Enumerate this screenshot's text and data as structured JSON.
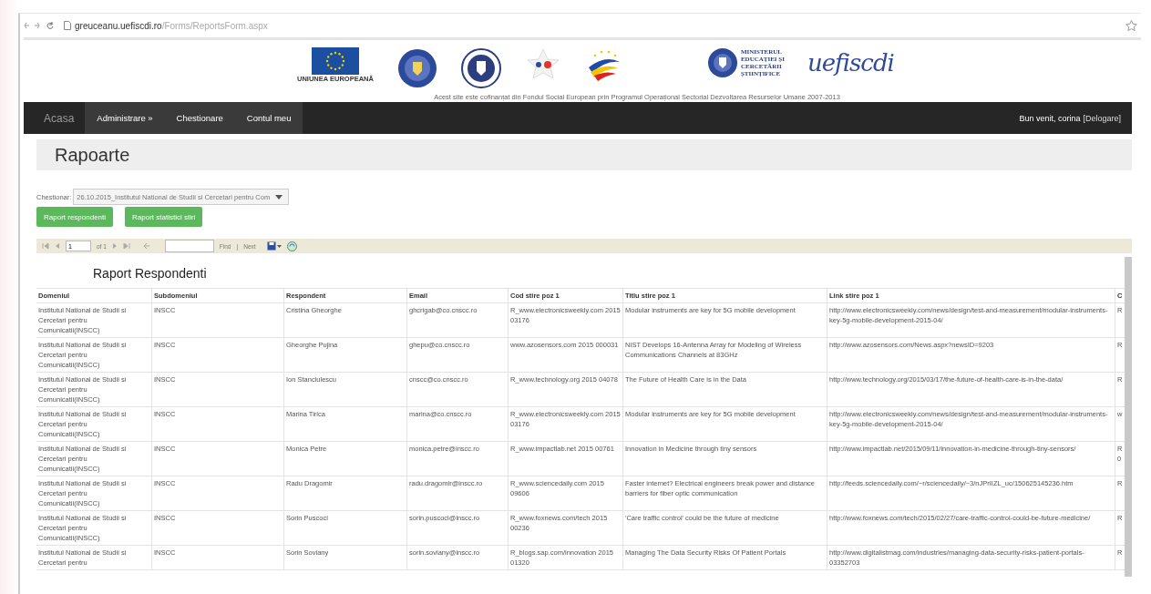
{
  "browser": {
    "url_host": "greuceanu.uefiscdi.ro",
    "url_path": "/Forms/ReportsForm.aspx"
  },
  "header": {
    "eu_caption": "UNIUNEA EUROPEANĂ",
    "ministry_text": "MINISTERUL EDUCAȚIEI ȘI CERCETĂRII ȘTIINȚIFICE",
    "brand": "uefiscdi",
    "caption": "Acest site este cofinanțat din Fondul Social European prin Programul Operațional Sectorial Dezvoltarea Resurselor Umane 2007-2013"
  },
  "nav": {
    "brand": "Acasa",
    "items": [
      {
        "label": "Administrare »",
        "selected": false
      },
      {
        "label": "Chestionare",
        "selected": false
      },
      {
        "label": "Contul meu",
        "selected": false
      }
    ],
    "welcome": "Bun venit, corina",
    "logout": "[Delogare]"
  },
  "page_title": "Rapoarte",
  "form": {
    "select_label": "Chestionar:",
    "select_value": "26.10.2015_Institutul National de Studii si Cercetari pentru Com",
    "buttons": [
      "Raport respondenti",
      "Raport statistici stiri"
    ]
  },
  "toolbar": {
    "page": "1",
    "of": "of 1",
    "find": "Find",
    "separator": "|",
    "next": "Next"
  },
  "report": {
    "title": "Raport Respondenti",
    "columns": [
      "Domeniul",
      "Subdomeniul",
      "Respondent",
      "Email",
      "Cod stire poz 1",
      "Titlu stire poz 1",
      "Link stire poz 1",
      "C"
    ],
    "rows": [
      [
        "Institutul National de Studii si Cercetari pentru Comunicatii(INSCC)",
        "INSCC",
        "Cristina Gheorghe",
        "ghcrigab@co.cnscc.ro",
        "R_www.electronicsweekly.com 2015 03176",
        "Modular instruments are key for 5G mobile development",
        "http://www.electronicsweekly.com/news/design/test-and-measurement/modular-instruments-key-5g-mobile-development-2015-04/",
        "R"
      ],
      [
        "Institutul National de Studii si Cercetari pentru Comunicatii(INSCC)",
        "INSCC",
        "Gheorghe Pujina",
        "ghepu@co.cnscc.ro",
        "www.azosensors.com 2015 000031",
        "NIST Develops 16-Antenna Array for Modeling of Wireless Communications Channels at 83GHz",
        "http://www.azosensors.com/News.aspx?newsID=9203",
        "R"
      ],
      [
        "Institutul National de Studii si Cercetari pentru Comunicatii(INSCC)",
        "INSCC",
        "Ion Stanciulescu",
        "cnscc@co.cnscc.ro",
        "R_www.technology.org 2015 04078",
        "The Future of Health Care is in the Data",
        "http://www.technology.org/2015/03/17/the-future-of-health-care-is-in-the-data/",
        "R"
      ],
      [
        "Institutul National de Studii si Cercetari pentru Comunicatii(INSCC)",
        "INSCC",
        "Marina Tirica",
        "marina@co.cnscc.ro",
        "R_www.electronicsweekly.com 2015 03176",
        "Modular instruments are key for 5G mobile development",
        "http://www.electronicsweekly.com/news/design/test-and-measurement/modular-instruments-key-5g-mobile-development-2015-04/",
        "w"
      ],
      [
        "Institutul National de Studii si Cercetari pentru Comunicatii(INSCC)",
        "INSCC",
        "Monica  Petre",
        "monica.petre@inscc.ro",
        "R_www.impactlab.net 2015 00761",
        "Innovation in Medicine through tiny sensors",
        "http://www.impactlab.net/2015/09/11/innovation-in-medicine-through-tiny-sensors/",
        "R 0"
      ],
      [
        "Institutul National de Studii si Cercetari pentru Comunicatii(INSCC)",
        "INSCC",
        "Radu Dragomir",
        "radu.dragomir@inscc.ro",
        "R_www.sciencedaily.com 2015 09606",
        "Faster internet? Electrical engineers break power and distance barriers for fiber optic communication",
        "http://feeds.sciencedaily.com/~r/sciencedaily/~3/nJPrIIZL_uc/150625145236.htm",
        "R"
      ],
      [
        "Institutul National de Studii si Cercetari pentru Comunicatii(INSCC)",
        "INSCC",
        "Sorin Puscoci",
        "sorin.puscoci@inscc.ro",
        "R_www.foxnews.com/tech 2015 00236",
        "'Care traffic control' could be the future of medicine",
        "http://www.foxnews.com/tech/2015/02/27/care-traffic-control-could-be-future-medicine/",
        "R"
      ],
      [
        "Institutul National de Studii si Cercetari pentru",
        "INSCC",
        "Sorin Soviany",
        "sorin.soviany@inscc.ro",
        "R_blogs.sap.com/innovation 2015 01320",
        "Managing The Data Security Risks Of Patient Portals",
        "http://www.digitalistmag.com/industries/managing-data-security-risks-patient-portals-03352703",
        "R"
      ]
    ]
  }
}
